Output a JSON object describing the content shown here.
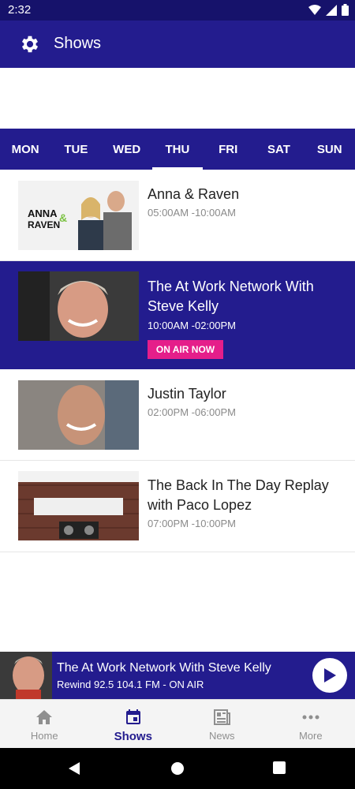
{
  "status": {
    "time": "2:32"
  },
  "app_bar": {
    "title": "Shows",
    "settings_icon": "gear-icon"
  },
  "day_tabs": [
    {
      "label": "MON",
      "active": false
    },
    {
      "label": "TUE",
      "active": false
    },
    {
      "label": "WED",
      "active": false
    },
    {
      "label": "THU",
      "active": true
    },
    {
      "label": "FRI",
      "active": false
    },
    {
      "label": "SAT",
      "active": false
    },
    {
      "label": "SUN",
      "active": false
    }
  ],
  "shows": [
    {
      "title": "Anna & Raven",
      "time": "05:00AM -10:00AM",
      "on_air": false
    },
    {
      "title": "The At Work Network With Steve Kelly",
      "time": "10:00AM -02:00PM",
      "on_air": true,
      "badge": "ON AIR NOW"
    },
    {
      "title": "Justin Taylor",
      "time": "02:00PM -06:00PM",
      "on_air": false
    },
    {
      "title": "The Back In The Day Replay with Paco Lopez",
      "time": "07:00PM -10:00PM",
      "on_air": false
    }
  ],
  "now_playing": {
    "title": "The At Work Network With Steve Kelly",
    "subtitle": "Rewind 92.5 104.1 FM  - ON AIR"
  },
  "bottom_nav": [
    {
      "label": "Home",
      "icon": "home-icon",
      "active": false
    },
    {
      "label": "Shows",
      "icon": "calendar-icon",
      "active": true
    },
    {
      "label": "News",
      "icon": "newspaper-icon",
      "active": false
    },
    {
      "label": "More",
      "icon": "more-dots-icon",
      "active": false
    }
  ],
  "colors": {
    "primary": "#231c8e",
    "status": "#16126b",
    "accent": "#e51e8a"
  }
}
